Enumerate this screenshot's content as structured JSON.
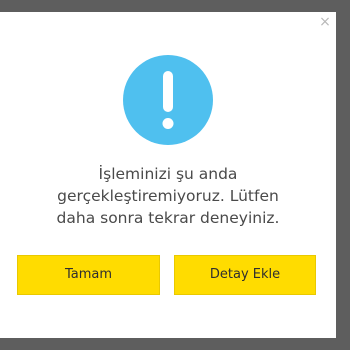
{
  "dialog": {
    "close_glyph": "×",
    "icon": "exclamation-circle-icon",
    "icon_color": "#4fc0ef",
    "message_lines": [
      "İşleminizi şu anda",
      "gerçekleştiremiyoruz. Lütfen",
      "daha sonra tekrar deneyiniz."
    ],
    "ok_label": "Tamam",
    "detail_label": "Detay Ekle",
    "button_color": "#ffdc00"
  }
}
